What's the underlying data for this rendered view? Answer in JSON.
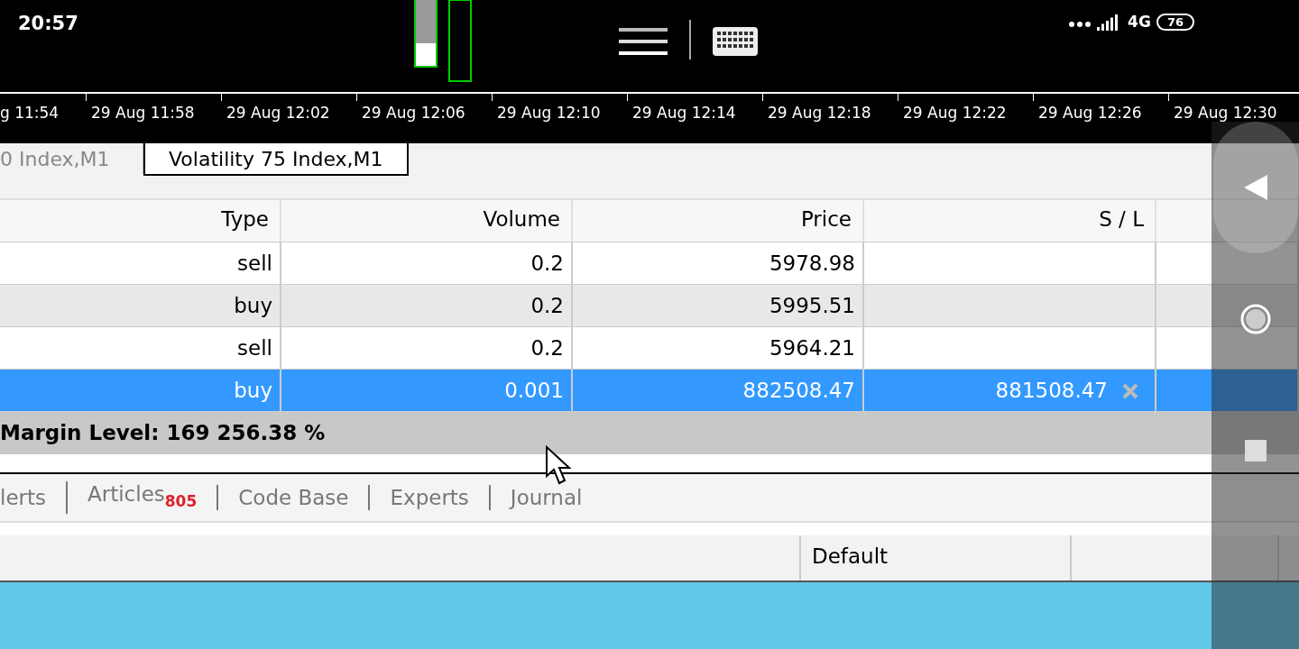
{
  "status_bar": {
    "time": "20:57",
    "network": "4G",
    "battery": "76"
  },
  "time_axis": [
    "g 11:54",
    "29 Aug 11:58",
    "29 Aug 12:02",
    "29 Aug 12:06",
    "29 Aug 12:10",
    "29 Aug 12:14",
    "29 Aug 12:18",
    "29 Aug 12:22",
    "29 Aug 12:26",
    "29 Aug 12:30"
  ],
  "chart_tabs": [
    {
      "label": "0 Index,M1",
      "selected": false
    },
    {
      "label": "Volatility 75 Index,M1",
      "selected": true
    }
  ],
  "table": {
    "columns": [
      "Type",
      "Volume",
      "Price",
      "S / L"
    ],
    "rows": [
      {
        "cells": [
          "sell",
          "0.2",
          "5978.98",
          ""
        ],
        "selected": false
      },
      {
        "cells": [
          "buy",
          "0.2",
          "5995.51",
          ""
        ],
        "selected": false
      },
      {
        "cells": [
          "sell",
          "0.2",
          "5964.21",
          ""
        ],
        "selected": false
      },
      {
        "cells": [
          "buy",
          "0.001",
          "882508.47",
          "881508.47"
        ],
        "selected": true
      }
    ],
    "summary": "Margin Level: 169 256.38 %"
  },
  "bottom_tabs": [
    {
      "label": "lerts"
    },
    {
      "label": "Articles",
      "badge": "805"
    },
    {
      "label": "Code Base"
    },
    {
      "label": "Experts"
    },
    {
      "label": "Journal"
    }
  ],
  "status_line": {
    "profile": "Default"
  }
}
